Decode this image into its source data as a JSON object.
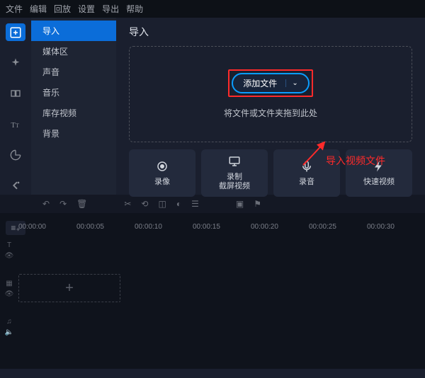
{
  "menubar": [
    "文件",
    "编辑",
    "回放",
    "设置",
    "导出",
    "帮助"
  ],
  "sidemenu": {
    "items": [
      "导入",
      "媒体区",
      "声音",
      "音乐",
      "库存视频",
      "背景"
    ],
    "selected_index": 0
  },
  "content": {
    "title": "导入",
    "add_file_label": "添加文件",
    "drop_hint": "将文件或文件夹拖到此处"
  },
  "annotation": "导入视频文件",
  "actions": [
    {
      "label": "录像",
      "icon": "camera"
    },
    {
      "label": "录制\n截屏视频",
      "icon": "monitor"
    },
    {
      "label": "录音",
      "icon": "mic"
    },
    {
      "label": "快速视频",
      "icon": "bolt"
    }
  ],
  "timeline": {
    "ticks": [
      "00:00:00",
      "00:00:05",
      "00:00:10",
      "00:00:15",
      "00:00:20",
      "00:00:25",
      "00:00:30"
    ]
  }
}
